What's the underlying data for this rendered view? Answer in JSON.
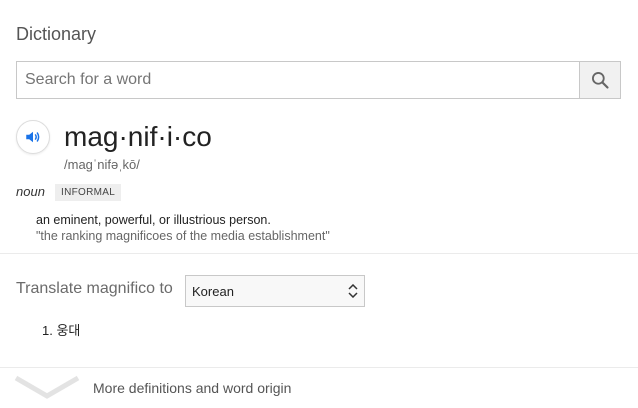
{
  "panel": {
    "title": "Dictionary"
  },
  "search": {
    "placeholder": "Search for a word",
    "value": ""
  },
  "entry": {
    "headword": "mag·nif·i·co",
    "phonetic": "/magˈnifəˌkō/",
    "part_of_speech": "noun",
    "register_badge": "INFORMAL",
    "definition": "an eminent, powerful, or illustrious person.",
    "example": "\"the ranking magnificoes of the media establishment\""
  },
  "translate": {
    "label": "Translate magnifico to",
    "selected_language": "Korean",
    "results": [
      {
        "number": "1.",
        "text": "웅대"
      }
    ]
  },
  "more": {
    "label": "More definitions and word origin"
  },
  "colors": {
    "accent": "#1a73e8",
    "divider": "#ebebeb",
    "muted_text": "#666666"
  }
}
